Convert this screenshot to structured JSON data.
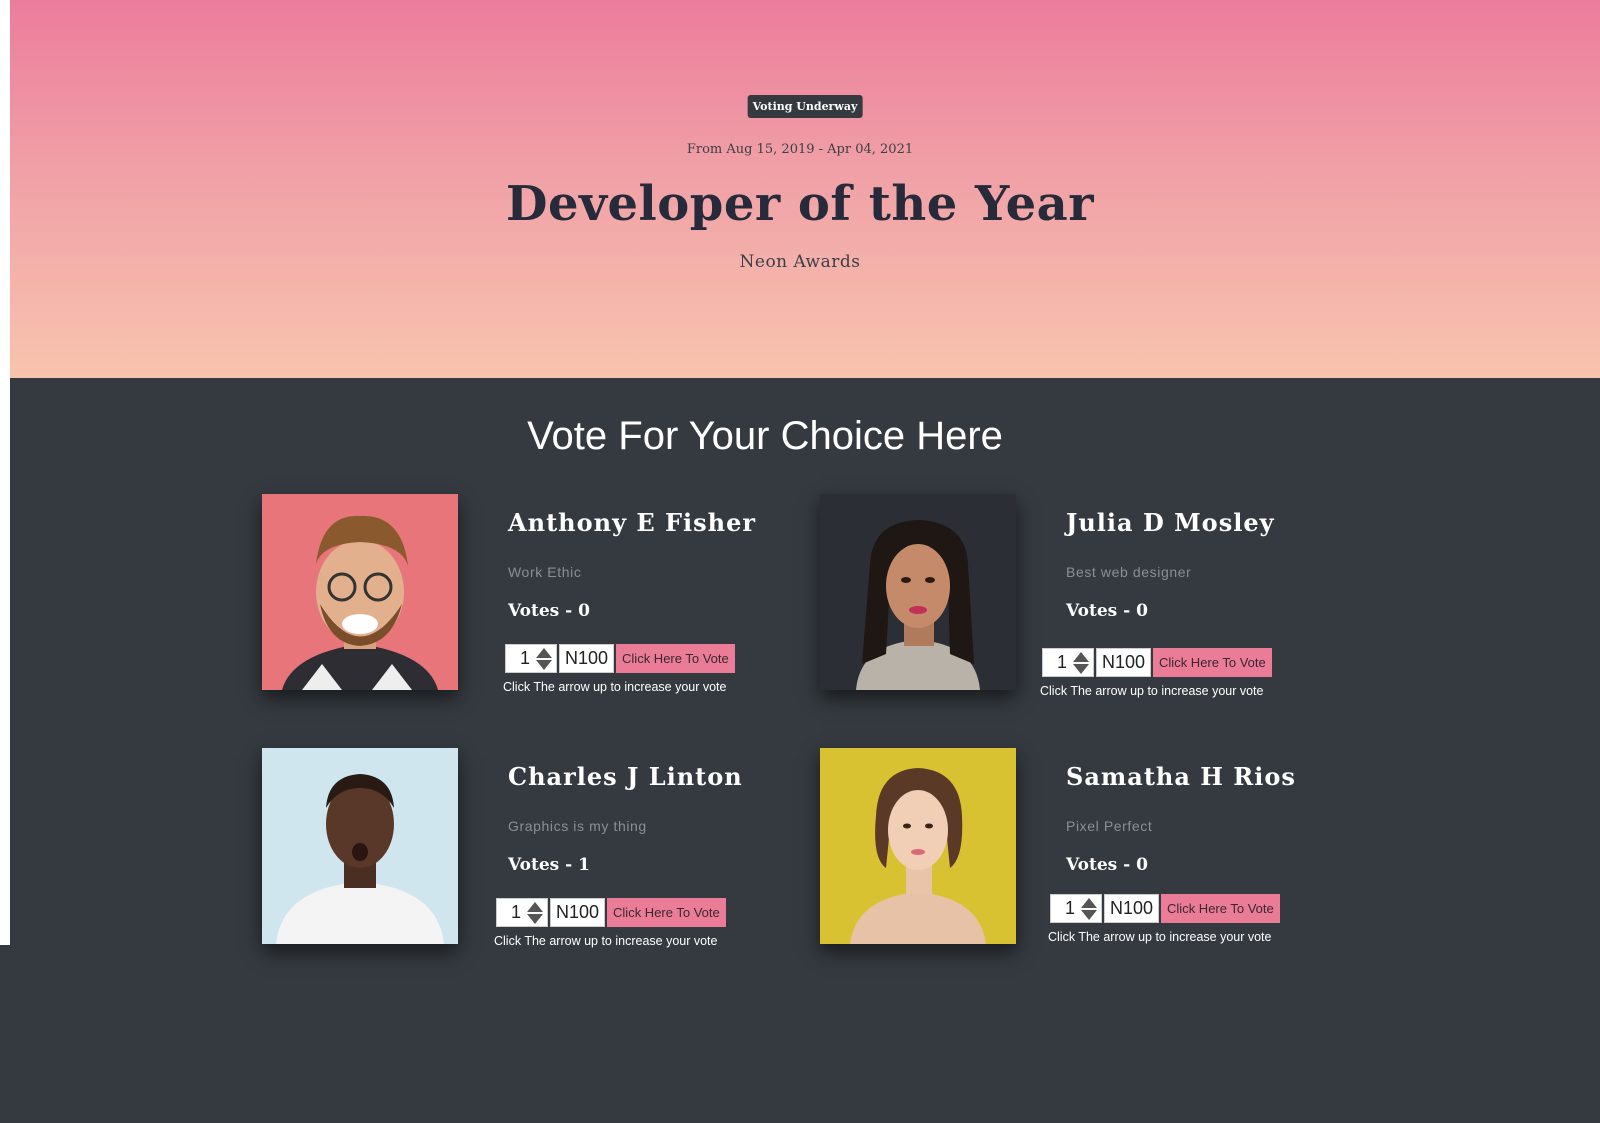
{
  "hero": {
    "status_badge": "Voting Underway",
    "date_range": "From Aug 15, 2019 - Apr 04, 2021",
    "title": "Developer of the Year",
    "subtitle": "Neon Awards"
  },
  "voting": {
    "section_title": "Vote For Your Choice Here",
    "candidates": [
      {
        "name": "Anthony E Fisher",
        "category": "Work Ethic",
        "votes": "Votes - 0",
        "quantity": "1",
        "price": "N100",
        "vote_button": "Click Here To Vote",
        "hint": "Click The arrow up to increase your vote"
      },
      {
        "name": "Julia D Mosley",
        "category": "Best web designer",
        "votes": "Votes - 0",
        "quantity": "1",
        "price": "N100",
        "vote_button": "Click Here To Vote",
        "hint": "Click The arrow up to increase your vote"
      },
      {
        "name": "Charles J Linton",
        "category": "Graphics is my thing",
        "votes": "Votes - 1",
        "quantity": "1",
        "price": "N100",
        "vote_button": "Click Here To Vote",
        "hint": "Click The arrow up to increase your vote"
      },
      {
        "name": "Samatha H Rios",
        "category": "Pixel Perfect",
        "votes": "Votes - 0",
        "quantity": "1",
        "price": "N100",
        "vote_button": "Click Here To Vote",
        "hint": "Click The arrow up to increase your vote"
      }
    ]
  },
  "colors": {
    "hero_top": "#ec7c9c",
    "hero_bottom": "#f8c4ae",
    "background": "#343a40",
    "vote_button": "#ea7c97"
  }
}
